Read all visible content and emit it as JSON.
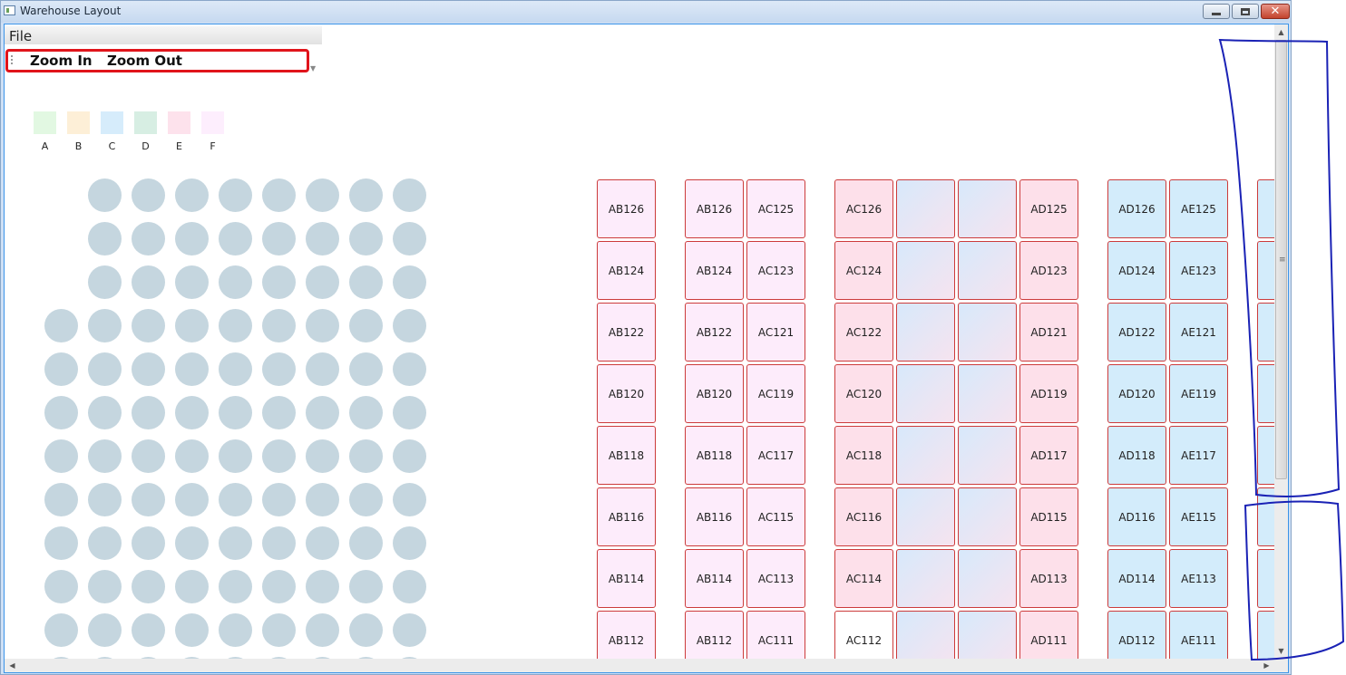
{
  "window": {
    "title": "Warehouse Layout"
  },
  "menu": {
    "file_label": "File"
  },
  "toolbar": {
    "zoom_in_label": "Zoom In",
    "zoom_out_label": "Zoom Out"
  },
  "legend": [
    {
      "label": "A",
      "color": "#e2f8e2"
    },
    {
      "label": "B",
      "color": "#fdefd7"
    },
    {
      "label": "C",
      "color": "#d6ecfb"
    },
    {
      "label": "D",
      "color": "#d7eee3"
    },
    {
      "label": "E",
      "color": "#fde2ec"
    },
    {
      "label": "F",
      "color": "#fdeefd"
    }
  ],
  "bin_columns": [
    {
      "style": "pink-light",
      "labels": [
        "AB126",
        "AB124",
        "AB122",
        "AB120",
        "AB118",
        "AB116",
        "AB114",
        "AB112"
      ]
    },
    {
      "style": "pink-light",
      "labels": [
        "AB126",
        "AB124",
        "AB122",
        "AB120",
        "AB118",
        "AB116",
        "AB114",
        "AB112"
      ]
    },
    {
      "style": "pink-light",
      "labels": [
        "AC125",
        "AC123",
        "AC121",
        "AC119",
        "AC117",
        "AC115",
        "AC113",
        "AC111"
      ]
    },
    {
      "style": "pink",
      "labels": [
        "AC126",
        "AC124",
        "AC122",
        "AC120",
        "AC118",
        "AC116",
        "AC114",
        "AC112"
      ]
    },
    {
      "style": "grad",
      "labels": [
        "",
        "",
        "",
        "",
        "",
        "",
        "",
        ""
      ]
    },
    {
      "style": "grad",
      "labels": [
        "",
        "",
        "",
        "",
        "",
        "",
        "",
        ""
      ]
    },
    {
      "style": "pink",
      "labels": [
        "AD125",
        "AD123",
        "AD121",
        "AD119",
        "AD117",
        "AD115",
        "AD113",
        "AD111"
      ]
    },
    {
      "style": "blue",
      "labels": [
        "AD126",
        "AD124",
        "AD122",
        "AD120",
        "AD118",
        "AD116",
        "AD114",
        "AD112"
      ]
    },
    {
      "style": "blue",
      "labels": [
        "AE125",
        "AE123",
        "AE121",
        "AE119",
        "AE117",
        "AE115",
        "AE113",
        "AE111"
      ]
    }
  ]
}
